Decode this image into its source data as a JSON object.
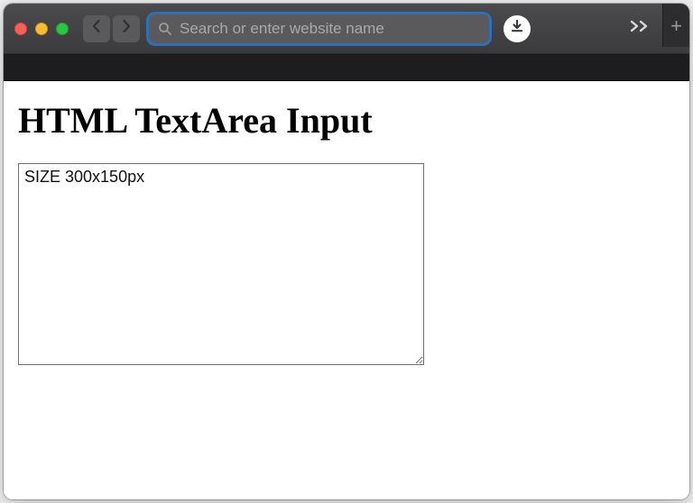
{
  "browser": {
    "address_placeholder": "Search or enter website name"
  },
  "page": {
    "heading": "HTML TextArea Input",
    "textarea_value": "SIZE 300x150px"
  }
}
